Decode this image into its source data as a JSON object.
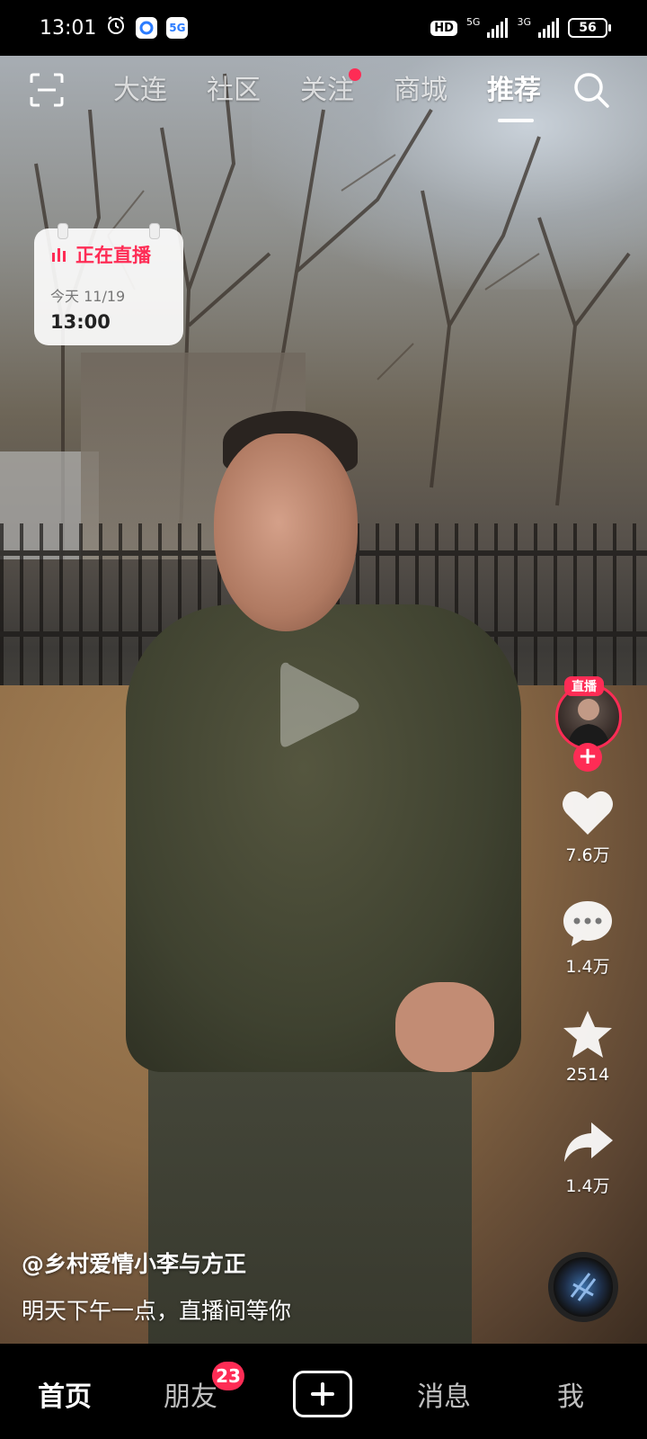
{
  "status_bar": {
    "time": "13:01",
    "hd": "HD",
    "net1": "5G",
    "net2": "3G",
    "battery": "56",
    "app_icon_5g": "5G"
  },
  "top_nav": {
    "tabs": [
      {
        "label": "大连"
      },
      {
        "label": "社区"
      },
      {
        "label": "关注"
      },
      {
        "label": "商城"
      },
      {
        "label": "推荐"
      }
    ],
    "active_tab": "推荐"
  },
  "live_card": {
    "title": "正在直播",
    "date": "今天 11/19",
    "time": "13:00"
  },
  "rail": {
    "avatar_badge": "直播",
    "like_count": "7.6万",
    "comment_count": "1.4万",
    "favorite_count": "2514",
    "share_count": "1.4万"
  },
  "caption": {
    "author": "@乡村爱情小李与方正",
    "description": "明天下午一点，直播间等你"
  },
  "bottom_nav": {
    "home": "首页",
    "friends": "朋友",
    "friends_badge": "23",
    "messages": "消息",
    "me": "我"
  },
  "colors": {
    "accent": "#fe2c55",
    "background": "#000000"
  },
  "icons": [
    "alarm-icon",
    "scan-icon",
    "search-icon",
    "heart-icon",
    "comment-icon",
    "star-icon",
    "share-icon",
    "plus-icon",
    "play-icon",
    "music-disc-icon"
  ]
}
